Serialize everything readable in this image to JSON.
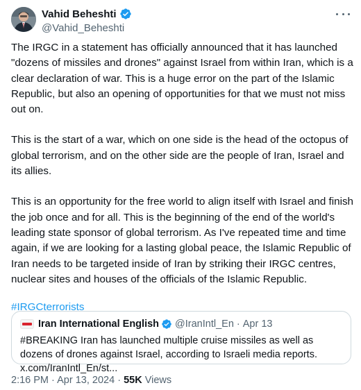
{
  "author": {
    "display_name": "Vahid Beheshti",
    "handle": "@Vahid_Beheshti"
  },
  "tweet": {
    "paragraphs": [
      "The IRGC in a statement has officially announced that it has launched \"dozens of missiles and drones\" against Israel from within Iran, which is a clear declaration of war. This is a huge error on the part of the Islamic Republic, but also an opening of opportunities for that we must not miss out on.",
      "This is the start of a war, which on one side is the head of the octopus of global terrorism, and on the other side are the people of Iran, Israel and its allies.",
      "This is an opportunity for the free world to align itself with Israel and finish the job once and for all. This is the beginning of the end of the world's leading state sponsor of global terrorism. As I've repeated time and time again, if we are looking for a lasting global peace, the Islamic Republic of Iran needs to be targeted inside of Iran by striking their IRGC centres, nuclear sites and houses of the officials of the Islamic Republic."
    ],
    "hashtag": "#IRGCterrorists"
  },
  "quote": {
    "display_name": "Iran International English",
    "handle": "@IranIntl_En",
    "separator": "·",
    "date": "Apr 13",
    "text": "#BREAKING Iran has launched multiple cruise missiles as well as dozens of drones against Israel, according to Israeli media reports. x.com/IranIntl_En/st..."
  },
  "meta": {
    "time": "2:16 PM",
    "separator": "·",
    "date": "Apr 13, 2024",
    "views_count": "55K",
    "views_label": "Views"
  },
  "colors": {
    "link": "#1d9bf0",
    "verified": "#1d9bf0",
    "secondary_text": "#536471",
    "border": "#cfd9de"
  }
}
